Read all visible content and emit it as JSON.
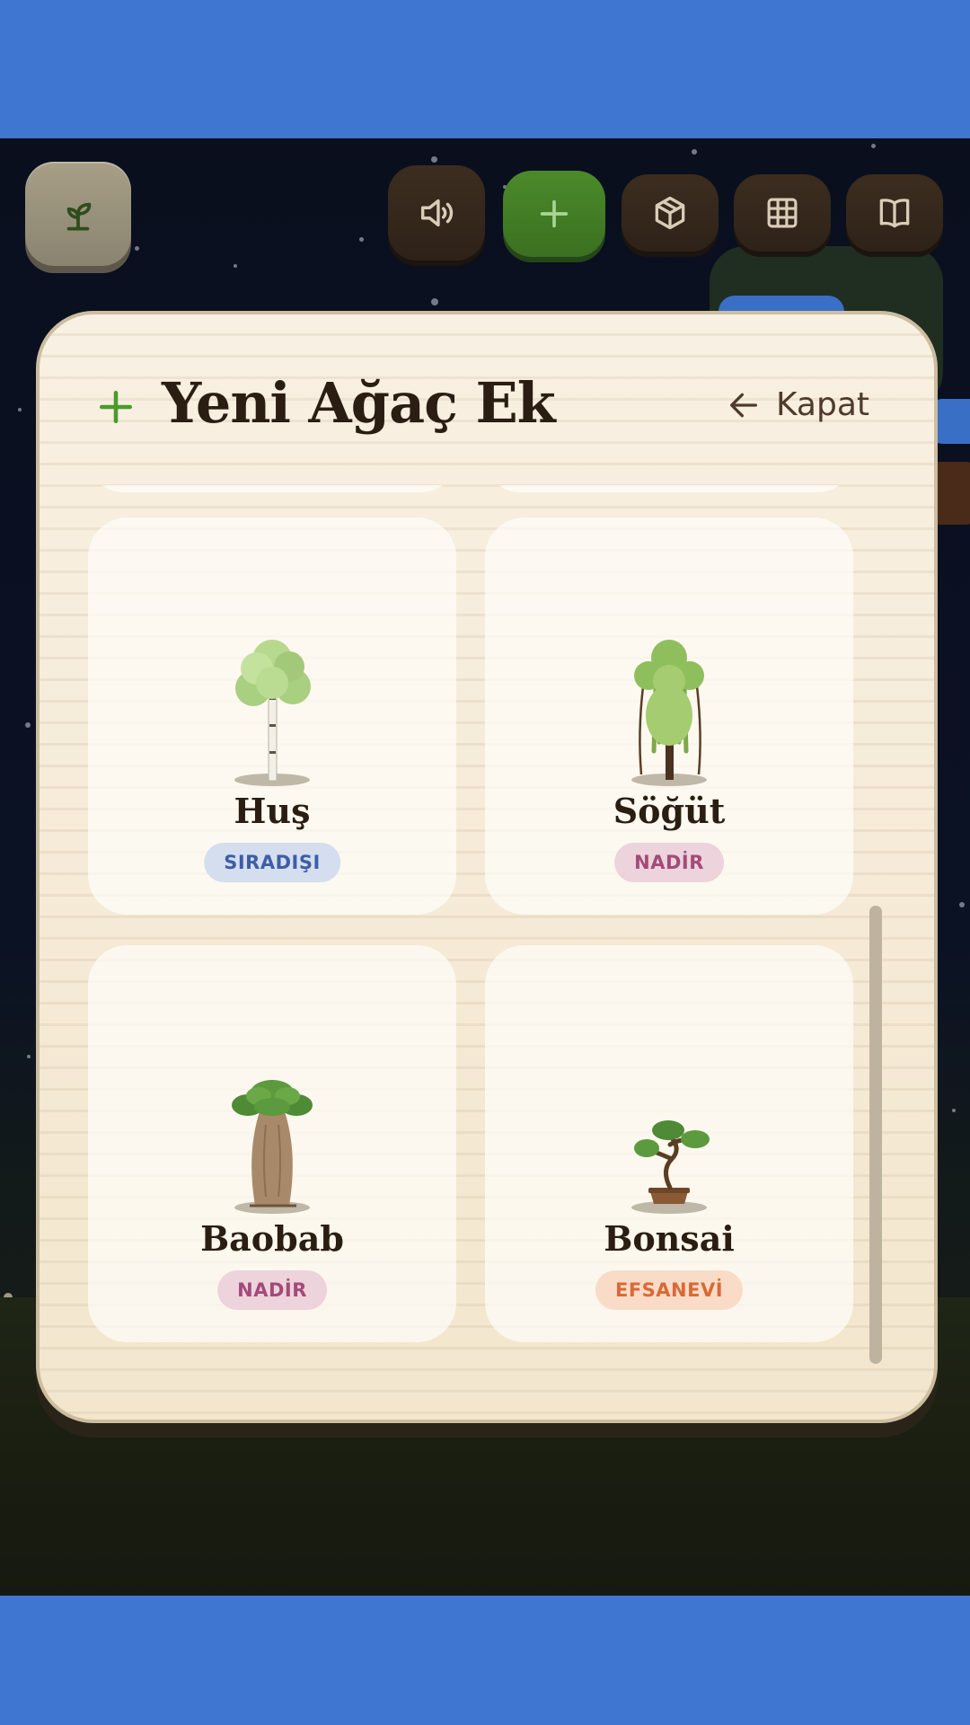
{
  "toolbar": {
    "home_icon": "sprout-icon",
    "sound_icon": "speaker-icon",
    "add_icon": "plus-icon",
    "inventory_icon": "box-icon",
    "grid_icon": "grid-icon",
    "journal_icon": "book-icon"
  },
  "modal": {
    "title": "Yeni Ağaç Ek",
    "close_label": "Kapat",
    "accent_color": "#4a9a2c"
  },
  "trees": [
    {
      "name": "Huş",
      "rarity": "SIRADIŞI",
      "rarity_color": "#3d5ea6",
      "icon": "birch-tree-icon"
    },
    {
      "name": "Söğüt",
      "rarity": "NADİR",
      "rarity_color": "#a44a78",
      "icon": "willow-tree-icon"
    },
    {
      "name": "Baobab",
      "rarity": "NADİR",
      "rarity_color": "#a44a78",
      "icon": "baobab-tree-icon"
    },
    {
      "name": "Bonsai",
      "rarity": "EFSANEVİ",
      "rarity_color": "#d96a38",
      "icon": "bonsai-tree-icon"
    }
  ]
}
